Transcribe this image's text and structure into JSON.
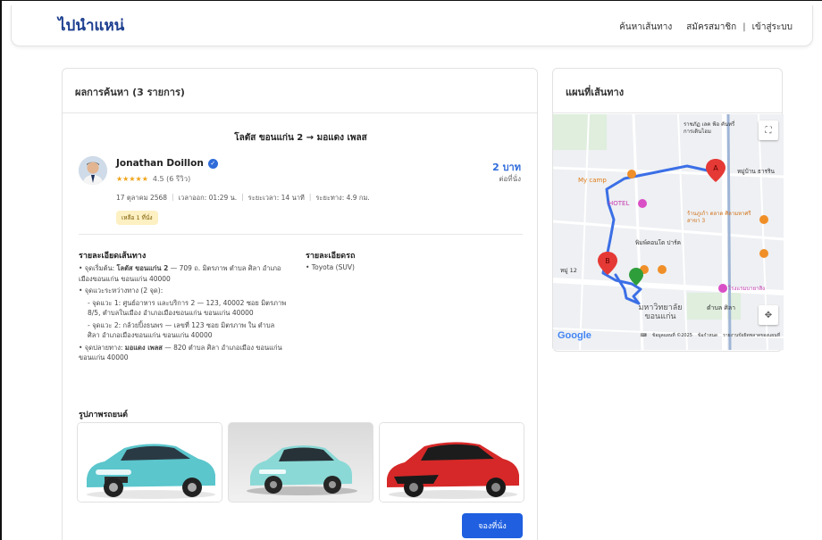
{
  "brand": "ไปนำแหน่",
  "nav": {
    "search_route": "ค้นหาเส้นทาง",
    "register": "สมัครสมาชิก",
    "separator": "|",
    "login": "เข้าสู่ระบบ"
  },
  "results": {
    "header": "ผลการค้นหา (3 รายการ)",
    "route_title": "โลตัส ขอนแก่น 2 → มอแดง เพลส",
    "driver": {
      "name": "Jonathan Doillon",
      "stars": "★★★★★",
      "rating_text": "4.5 (6 รีวิว)"
    },
    "price": "2 บาท",
    "per_seat": "ต่อที่นั่ง",
    "trip_meta": {
      "date": "17 ตุลาคม 2568",
      "departure": "เวลาออก: 01:29 น.",
      "duration": "ระยะเวลา: 14 นาที",
      "distance": "ระยะทาง: 4.9 กม."
    },
    "seats_left": "เหลือ 1 ที่นั่ง",
    "route_details": {
      "title": "รายละเอียดเส้นทาง",
      "start_prefix": "• จุดเริ่มต้น: ",
      "start_name": "โลตัส ขอนแก่น 2",
      "start_address": " — 709 ถ. มิตรภาพ ตำบล ศิลา อำเภอเมืองขอนแก่น ขอนแก่น 40000",
      "waypoints_header": "• จุดแวะระหว่างทาง (2 จุด):",
      "waypoint_1": "- จุดแวะ 1: ศูนย์อาหาร และบริการ 2 — 123, 40002 ซอย มิตรภาพ 8/5, ตำบลในเมือง อำเภอเมืองขอนแก่น ขอนแก่น 40000",
      "waypoint_2": "- จุดแวะ 2: กล้วยปิ้งธนพร — เลขที่ 123 ซอย มิตรภาพ ใน ตำบล ศิลา อำเภอเมืองขอนแก่น ขอนแก่น 40000",
      "end_prefix": "• จุดปลายทาง: ",
      "end_name": "มอแดง เพลส",
      "end_address": " — 820 ตำบล ศิลา อำเภอเมือง ขอนแก่น ขอนแก่น 40000"
    },
    "car_details": {
      "title": "รายละเอียดรถ",
      "model": "• Toyota (SUV)"
    },
    "photos_title": "รูปภาพรถยนต์",
    "book_button": "จองที่นั่ง"
  },
  "map": {
    "header": "แผนที่เส้นทาง",
    "marker_a": "A",
    "marker_b": "B",
    "google": "Google",
    "footer_data": "ข้อมูลแผนที่ ©2025",
    "footer_terms": "ข้อกำหนด",
    "footer_report": "รายงานข้อผิดพลาดของแผนที่",
    "labels": {
      "my_camp": "My camp",
      "hotel": "HOTEL",
      "rajabhat": "ราชภัฏ เลค ฟ้อ คันทรี่ การเดินไฮม",
      "village": "หมู่บ้าน ธารริน",
      "market": "ร้านภูเก้า ตลาด ศิลามหาศรีสาขา 3",
      "condo": "พิมพ์คอนโด ปาร์ค",
      "moo12": "หมู่ 12",
      "university": "มหาวิทยาลัย ขอนแก่น",
      "sila": "ตำบล ศิลา",
      "hotel2": "โรงแรมบายาสิง"
    },
    "colors": {
      "route": "#3b6fe6",
      "marker": "#e53935",
      "waypoint": "#2e9e3a"
    }
  }
}
